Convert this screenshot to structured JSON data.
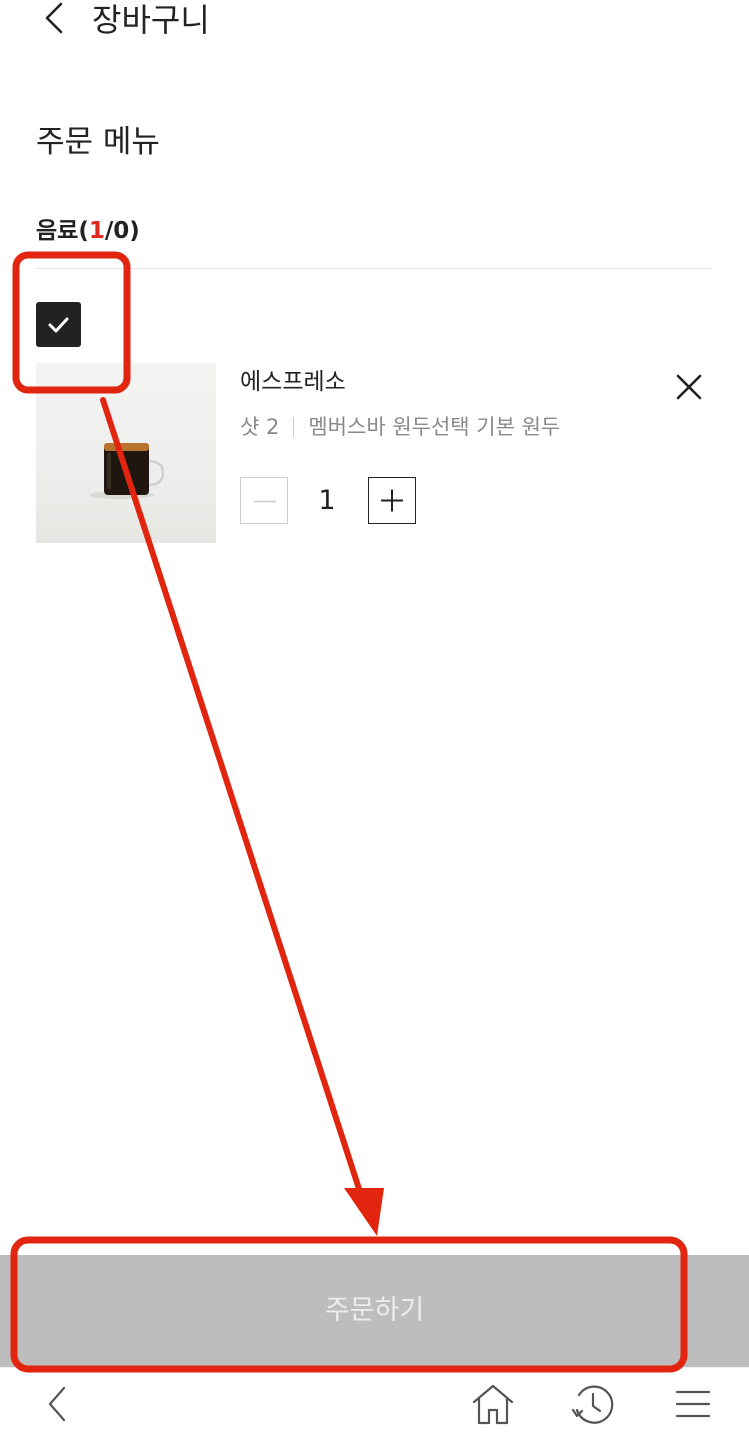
{
  "header": {
    "back_icon": "chevron-left-icon",
    "title": "장바구니"
  },
  "section": {
    "title": "주문 메뉴"
  },
  "category": {
    "name": "음료(",
    "selected_count": "1",
    "rest": "/0)"
  },
  "cart_item": {
    "checked": true,
    "name": "에스프레소",
    "option_shot": "샷 2",
    "option_bean": "멤버스바 원두선택 기본 원두",
    "quantity": "1",
    "remove_icon": "close-icon",
    "minus_icon": "minus-icon",
    "plus_icon": "plus-icon"
  },
  "order_button": {
    "label": "주문하기"
  },
  "bottom_nav": {
    "items": [
      "chevron-left-icon",
      "home-icon",
      "history-icon",
      "menu-icon"
    ]
  },
  "colors": {
    "accent_red": "#e0281f",
    "annotation_red": "#e1250e",
    "checkbox_fill": "#222222",
    "order_bar_disabled": "#bdbdbd"
  }
}
